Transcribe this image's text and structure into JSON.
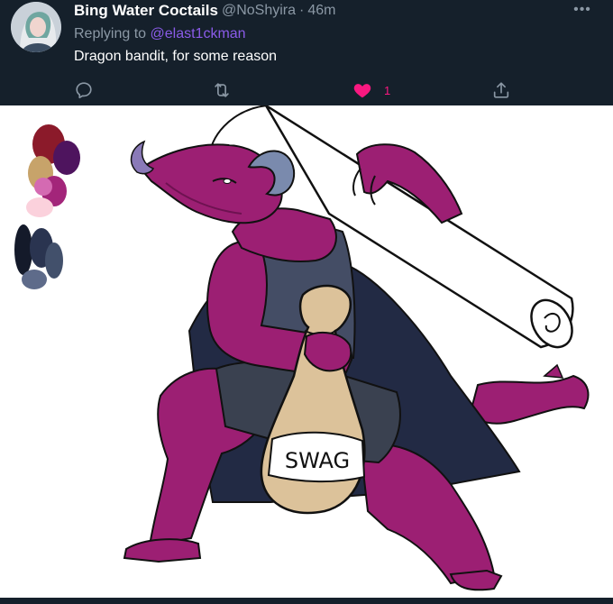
{
  "tweet": {
    "display_name": "Bing Water Coctails",
    "handle": "@NoShyira",
    "separator": "·",
    "time": "46m",
    "more_label": "•••",
    "reply_prefix": "Replying to",
    "reply_to": "@elast1ckman",
    "text": "Dragon bandit, for some reason",
    "like_count": "1",
    "liked": true
  },
  "artwork": {
    "bag_label": "SWAG",
    "palette_colors": [
      "#8b1a2a",
      "#4e145e",
      "#c7a36a",
      "#a3257a",
      "#d46ab2",
      "#fbd1dc",
      "#141a2a",
      "#2a3450",
      "#42506b",
      "#5e6b8a"
    ],
    "colors": {
      "dragon": "#9c1f73",
      "dragon_dark": "#6e1251",
      "coat": "#222a44",
      "shirt": "#444d65",
      "shorts": "#3a4150",
      "bag": "#dcc29a",
      "horn": "#7a8aad",
      "scroll": "#ffffff"
    }
  },
  "colors": {
    "background": "#15202b",
    "text_primary": "#ffffff",
    "text_secondary": "#8b98a5",
    "reply_link": "#8a5be8",
    "like": "#f91880"
  }
}
